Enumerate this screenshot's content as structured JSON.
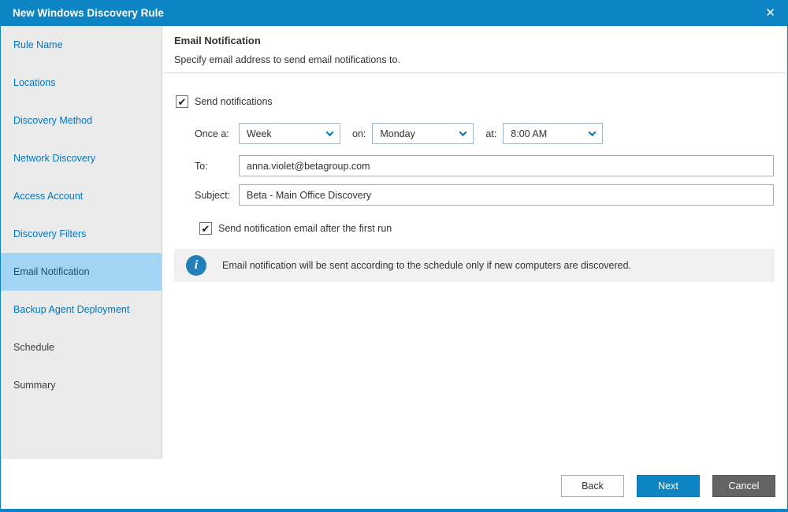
{
  "window": {
    "title": "New Windows Discovery Rule",
    "close_glyph": "✕"
  },
  "icons": {
    "check": "✔",
    "info": "i"
  },
  "sidebar": {
    "items": [
      {
        "label": "Rule Name",
        "state": "visited"
      },
      {
        "label": "Locations",
        "state": "visited"
      },
      {
        "label": "Discovery Method",
        "state": "visited"
      },
      {
        "label": "Network Discovery",
        "state": "visited"
      },
      {
        "label": "Access Account",
        "state": "visited"
      },
      {
        "label": "Discovery Filters",
        "state": "visited"
      },
      {
        "label": "Email Notification",
        "state": "active"
      },
      {
        "label": "Backup Agent Deployment",
        "state": "visited"
      },
      {
        "label": "Schedule",
        "state": "upcoming"
      },
      {
        "label": "Summary",
        "state": "upcoming"
      }
    ]
  },
  "content": {
    "heading": "Email Notification",
    "subheading": "Specify email address to send email notifications to.",
    "send_notifications_label": "Send notifications",
    "send_notifications_checked": true,
    "schedule": {
      "once_a_label": "Once a:",
      "frequency_value": "Week",
      "on_label": "on:",
      "day_value": "Monday",
      "at_label": "at:",
      "time_value": "8:00 AM"
    },
    "to_label": "To:",
    "to_value": "anna.violet@betagroup.com",
    "subject_label": "Subject:",
    "subject_value": "Beta - Main Office Discovery",
    "first_run_label": "Send notification email after the first run",
    "first_run_checked": true,
    "info_text": "Email notification will be sent according to the schedule only if new computers are discovered."
  },
  "footer": {
    "back_label": "Back",
    "next_label": "Next",
    "cancel_label": "Cancel"
  },
  "colors": {
    "accent_blue": "#0d84c4",
    "link_blue": "#0076c0",
    "active_step_bg": "#a3d4f3",
    "sidebar_bg": "#ebebeb",
    "info_banner_bg": "#f1f1f1",
    "cancel_gray": "#636363"
  }
}
